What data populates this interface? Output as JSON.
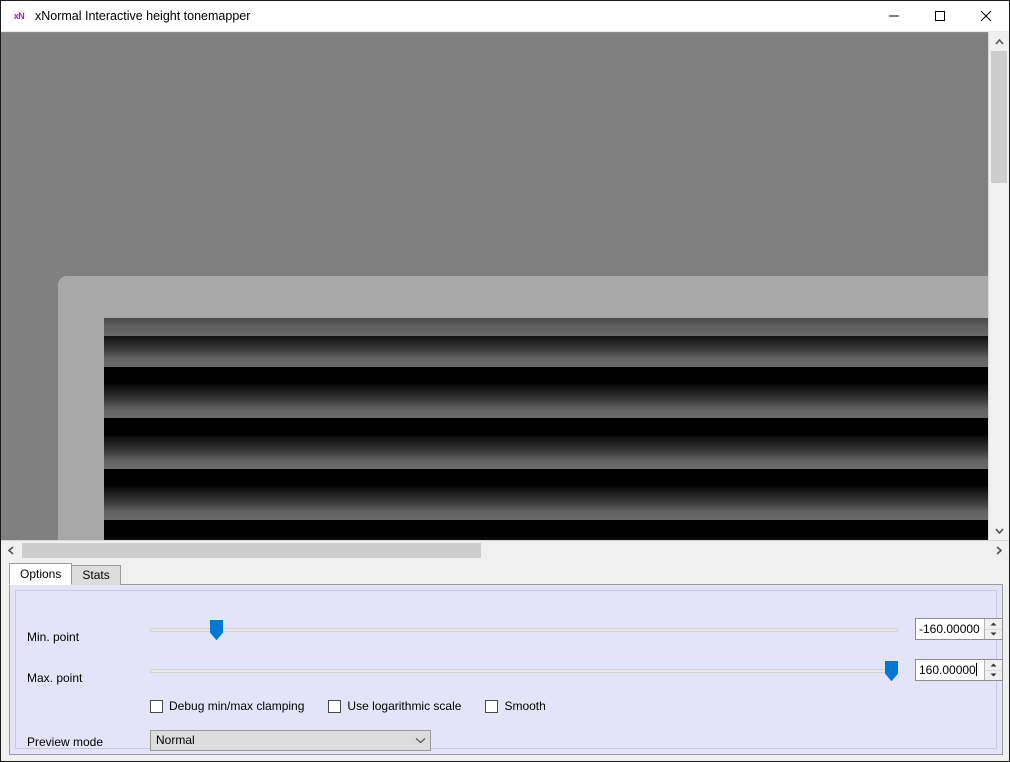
{
  "window": {
    "title": "xNormal Interactive height tonemapper",
    "icon": "xN",
    "icon_name": "xnormal-app-icon",
    "accent_blue": "#0078d4",
    "icon_color": "#a020d0",
    "panel_background": "#e4e4f8",
    "viewport_background": "#808080",
    "preview_panel_color": "#a8a8a8"
  },
  "window_controls": {
    "minimize": "–",
    "maximize": "□",
    "close": "✕"
  },
  "scrollbars": {
    "vertical": {
      "up_arrow": "▲",
      "down_arrow": "▼"
    },
    "horizontal": {
      "left_arrow": "◀",
      "right_arrow": "▶"
    }
  },
  "tabs": [
    {
      "label": "Options",
      "active": true
    },
    {
      "label": "Stats",
      "active": false
    }
  ],
  "options": {
    "min_point": {
      "label": "Min. point",
      "value": "-160.00000",
      "slider_percent": 9
    },
    "max_point": {
      "label": "Max. point",
      "value": "160.00000",
      "slider_percent": 100
    },
    "checkboxes": [
      {
        "label": "Debug min/max clamping",
        "checked": false
      },
      {
        "label": "Use logarithmic scale",
        "checked": false
      },
      {
        "label": "Smooth",
        "checked": false
      }
    ],
    "preview_mode": {
      "label": "Preview mode",
      "value": "Normal"
    }
  }
}
